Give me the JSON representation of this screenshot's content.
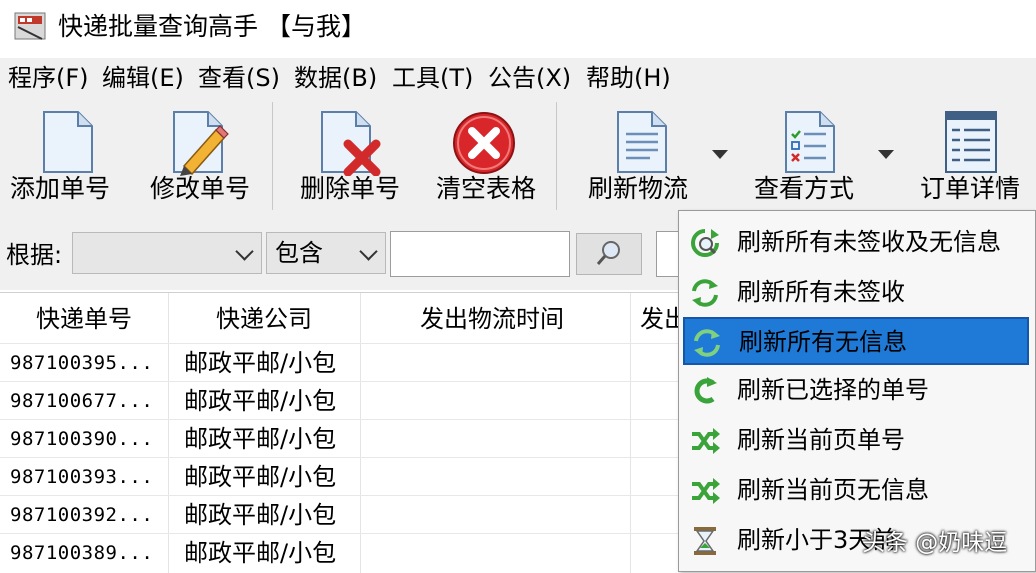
{
  "window": {
    "title": "快递批量查询高手 【与我】"
  },
  "menu": [
    "程序(F)",
    "编辑(E)",
    "查看(S)",
    "数据(B)",
    "工具(T)",
    "公告(X)",
    "帮助(H)"
  ],
  "toolbar": {
    "add": "添加单号",
    "edit": "修改单号",
    "delete": "删除单号",
    "clear": "清空表格",
    "refresh": "刷新物流",
    "view_mode": "查看方式",
    "order_detail": "订单详情"
  },
  "search": {
    "label": "根据:",
    "field_value": "",
    "condition_value": "包含",
    "keyword": ""
  },
  "table": {
    "columns": [
      "快递单号",
      "快递公司",
      "发出物流时间",
      "发出"
    ],
    "rows": [
      {
        "no": "987100395...",
        "company": "邮政平邮/小包"
      },
      {
        "no": "987100677...",
        "company": "邮政平邮/小包"
      },
      {
        "no": "987100390...",
        "company": "邮政平邮/小包"
      },
      {
        "no": "987100393...",
        "company": "邮政平邮/小包"
      },
      {
        "no": "987100392...",
        "company": "邮政平邮/小包"
      },
      {
        "no": "987100389...",
        "company": "邮政平邮/小包"
      }
    ]
  },
  "refresh_menu": {
    "items": [
      {
        "label": "刷新所有未签收及无信息",
        "icon": "refresh-search-icon"
      },
      {
        "label": "刷新所有未签收",
        "icon": "refresh-cycle-icon"
      },
      {
        "label": "刷新所有无信息",
        "icon": "refresh-cycle-icon",
        "selected": true
      },
      {
        "label": "刷新已选择的单号",
        "icon": "refresh-back-icon"
      },
      {
        "label": "刷新当前页单号",
        "icon": "shuffle-icon"
      },
      {
        "label": "刷新当前页无信息",
        "icon": "shuffle-icon"
      },
      {
        "label": "刷新小于3天前",
        "icon": "hourglass-icon"
      }
    ]
  },
  "watermark": "头条 @奶味逗",
  "colors": {
    "selection": "#1e7ad6",
    "icon_green": "#3aa33a",
    "toolbar_bg": "#f0f0f0"
  }
}
